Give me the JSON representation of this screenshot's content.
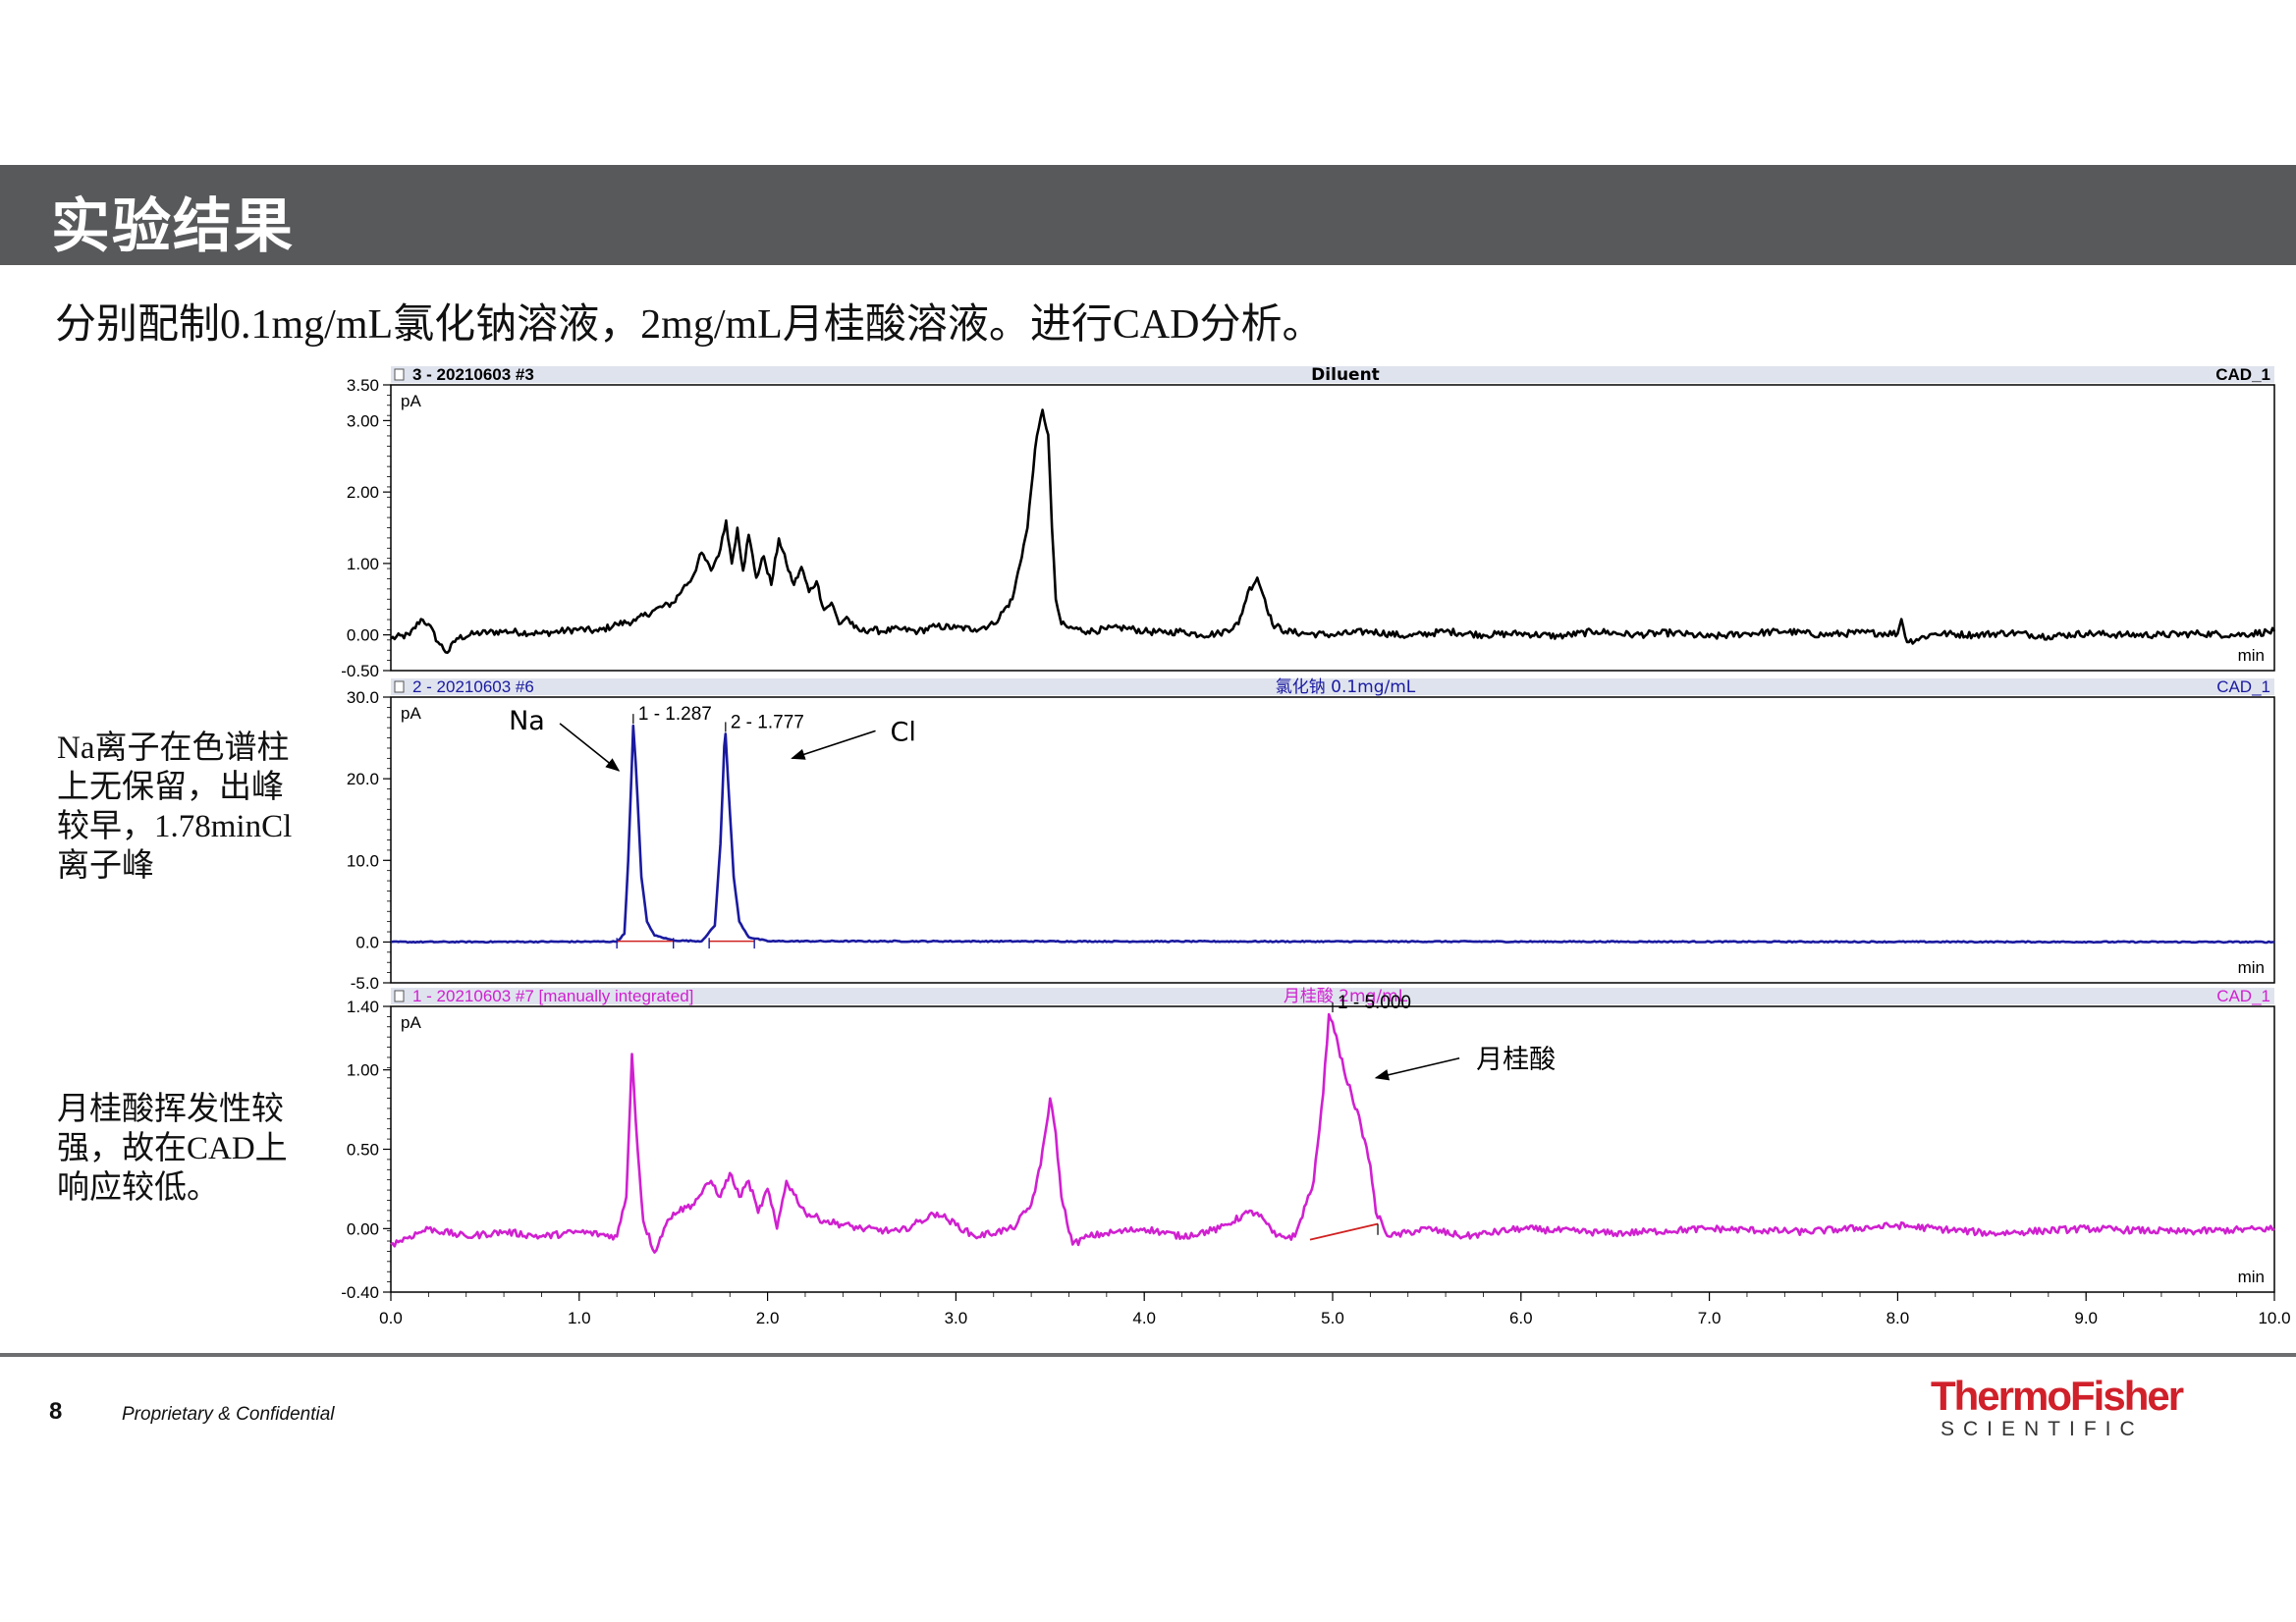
{
  "slide": {
    "title": "实验结果",
    "subtitle": "分别配制0.1mg/mL氯化钠溶液，2mg/mL月桂酸溶液。进行CAD分析。",
    "note_na": "Na离子在色谱柱上无保留，出峰较早，1.78minCl离子峰",
    "note_lauric": "月桂酸挥发性较强，故在CAD上响应较低。",
    "page_number": "8",
    "confidential": "Proprietary & Confidential",
    "logo_main": "ThermoFisher",
    "logo_sub": "SCIENTIFIC"
  },
  "chart_data": [
    {
      "type": "line",
      "header_left": "3 - 20210603 #3",
      "header_center": "Diluent",
      "header_right": "CAD_1",
      "ylabel": "pA",
      "xlabel": "min",
      "ylim": [
        -0.5,
        3.5
      ],
      "yticks": [
        "3.50",
        "3.00",
        "2.00",
        "1.00",
        "0.00",
        "-0.50"
      ],
      "ytick_values": [
        3.5,
        3.0,
        2.0,
        1.0,
        0.0,
        -0.5
      ],
      "color": "#000000",
      "x": [
        0.0,
        0.1,
        0.16,
        0.2,
        0.25,
        0.3,
        0.35,
        0.45,
        0.6,
        0.8,
        1.0,
        1.1,
        1.2,
        1.3,
        1.4,
        1.5,
        1.55,
        1.6,
        1.65,
        1.7,
        1.75,
        1.78,
        1.81,
        1.84,
        1.87,
        1.9,
        1.94,
        1.98,
        2.02,
        2.06,
        2.1,
        2.14,
        2.18,
        2.22,
        2.26,
        2.3,
        2.34,
        2.38,
        2.42,
        2.46,
        2.5,
        2.55,
        2.6,
        2.7,
        2.8,
        2.9,
        3.0,
        3.1,
        3.2,
        3.3,
        3.38,
        3.42,
        3.46,
        3.49,
        3.51,
        3.53,
        3.56,
        3.6,
        3.65,
        3.7,
        3.8,
        3.9,
        4.0,
        4.1,
        4.2,
        4.3,
        4.4,
        4.5,
        4.55,
        4.6,
        4.64,
        4.68,
        4.75,
        4.85,
        5.0,
        5.2,
        5.4,
        5.6,
        5.8,
        6.0,
        6.2,
        6.4,
        6.6,
        6.8,
        7.0,
        7.2,
        7.4,
        7.6,
        7.8,
        8.0,
        8.02,
        8.05,
        8.2,
        8.4,
        8.6,
        8.8,
        9.0,
        9.2,
        9.4,
        9.6,
        9.8,
        10.0
      ],
      "y": [
        -0.05,
        0.0,
        0.22,
        0.15,
        -0.1,
        -0.25,
        -0.05,
        0.02,
        0.05,
        0.02,
        0.08,
        0.05,
        0.15,
        0.2,
        0.35,
        0.45,
        0.65,
        0.8,
        1.15,
        0.9,
        1.2,
        1.6,
        1.0,
        1.5,
        0.9,
        1.4,
        0.8,
        1.1,
        0.7,
        1.35,
        1.0,
        0.7,
        0.95,
        0.6,
        0.75,
        0.35,
        0.45,
        0.15,
        0.25,
        0.1,
        0.05,
        0.08,
        0.05,
        0.08,
        0.05,
        0.12,
        0.1,
        0.08,
        0.15,
        0.5,
        1.5,
        2.6,
        3.15,
        2.8,
        1.5,
        0.5,
        0.15,
        0.1,
        0.08,
        0.05,
        0.08,
        0.1,
        0.05,
        0.03,
        0.05,
        0.0,
        0.02,
        0.15,
        0.6,
        0.8,
        0.5,
        0.15,
        0.05,
        0.02,
        0.0,
        0.05,
        -0.02,
        0.05,
        0.0,
        0.02,
        -0.02,
        0.05,
        0.0,
        0.03,
        -0.03,
        0.02,
        0.05,
        0.0,
        0.03,
        0.02,
        0.22,
        -0.1,
        0.02,
        0.0,
        0.03,
        -0.02,
        0.02,
        0.0,
        0.0,
        0.02,
        0.0,
        0.05
      ]
    },
    {
      "type": "line",
      "header_left": "2 - 20210603 #6",
      "header_center": "氯化钠 0.1mg/mL",
      "header_right": "CAD_1",
      "ylabel": "pA",
      "xlabel": "min",
      "ylim": [
        -5.0,
        30.0
      ],
      "yticks": [
        "30.0",
        "20.0",
        "10.0",
        "0.0",
        "-5.0"
      ],
      "ytick_values": [
        30.0,
        20.0,
        10.0,
        0.0,
        -5.0
      ],
      "color": "#1a1aa0",
      "x": [
        0.0,
        1.2,
        1.24,
        1.26,
        1.28,
        1.287,
        1.3,
        1.33,
        1.36,
        1.4,
        1.5,
        1.65,
        1.72,
        1.75,
        1.77,
        1.777,
        1.79,
        1.82,
        1.85,
        1.9,
        2.0,
        10.0
      ],
      "y": [
        0.0,
        0.05,
        1.0,
        10.0,
        22.0,
        26.5,
        22.0,
        8.0,
        2.5,
        0.8,
        0.2,
        0.1,
        2.0,
        12.0,
        24.0,
        25.5,
        20.0,
        8.0,
        2.5,
        0.6,
        0.1,
        0.0
      ],
      "peaks": [
        {
          "label": "1 - 1.287",
          "x": 1.287,
          "y": 26.5
        },
        {
          "label": "2 - 1.777",
          "x": 1.777,
          "y": 25.5
        }
      ],
      "annotations": [
        {
          "text": "Na",
          "target_x": 1.21,
          "target_y": 21.0
        },
        {
          "text": "Cl",
          "target_x": 2.13,
          "target_y": 22.5
        }
      ]
    },
    {
      "type": "line",
      "header_left": "1 - 20210603 #7 [manually integrated]",
      "header_center": "月桂酸 2mg/mL",
      "header_right": "CAD_1",
      "ylabel": "pA",
      "xlabel": "min",
      "ylim": [
        -0.4,
        1.4
      ],
      "yticks": [
        "1.40",
        "1.00",
        "0.50",
        "0.00",
        "-0.40"
      ],
      "ytick_values": [
        1.4,
        1.0,
        0.5,
        0.0,
        -0.4
      ],
      "color": "#d020d0",
      "xticks": [
        "0.0",
        "1.0",
        "2.0",
        "3.0",
        "4.0",
        "5.0",
        "6.0",
        "7.0",
        "8.0",
        "9.0",
        "10.0"
      ],
      "xtick_values": [
        0,
        1,
        2,
        3,
        4,
        5,
        6,
        7,
        8,
        9,
        10
      ],
      "x": [
        0.0,
        0.2,
        0.4,
        0.6,
        0.8,
        1.0,
        1.2,
        1.25,
        1.28,
        1.31,
        1.34,
        1.4,
        1.45,
        1.5,
        1.6,
        1.7,
        1.75,
        1.8,
        1.85,
        1.9,
        1.95,
        2.0,
        2.05,
        2.1,
        2.2,
        2.3,
        2.5,
        2.7,
        2.9,
        3.1,
        3.3,
        3.4,
        3.45,
        3.5,
        3.53,
        3.56,
        3.62,
        3.7,
        3.8,
        4.0,
        4.2,
        4.4,
        4.55,
        4.6,
        4.7,
        4.8,
        4.9,
        4.95,
        4.98,
        5.0,
        5.03,
        5.06,
        5.1,
        5.15,
        5.2,
        5.23,
        5.3,
        5.5,
        5.7,
        6.0,
        6.5,
        7.0,
        7.5,
        8.0,
        8.5,
        9.0,
        9.5,
        10.0
      ],
      "y": [
        -0.1,
        0.0,
        -0.05,
        -0.02,
        -0.05,
        -0.02,
        -0.05,
        0.2,
        1.1,
        0.5,
        0.05,
        -0.15,
        0.0,
        0.1,
        0.15,
        0.3,
        0.2,
        0.35,
        0.2,
        0.3,
        0.1,
        0.25,
        0.0,
        0.3,
        0.1,
        0.05,
        0.0,
        -0.02,
        0.1,
        -0.05,
        0.0,
        0.15,
        0.4,
        0.82,
        0.6,
        0.2,
        -0.1,
        -0.05,
        -0.03,
        0.0,
        -0.05,
        0.0,
        0.1,
        0.1,
        -0.05,
        -0.05,
        0.3,
        0.85,
        1.35,
        1.3,
        1.15,
        1.0,
        0.85,
        0.65,
        0.4,
        0.1,
        -0.05,
        0.0,
        -0.05,
        0.0,
        -0.03,
        0.0,
        -0.02,
        0.02,
        -0.03,
        0.0,
        -0.02,
        0.0
      ],
      "peaks": [
        {
          "label": "1 - 5.000",
          "x": 5.0,
          "y": 1.35
        }
      ],
      "annotations": [
        {
          "text": "月桂酸",
          "target_x": 5.23,
          "target_y": 0.95
        }
      ]
    }
  ]
}
